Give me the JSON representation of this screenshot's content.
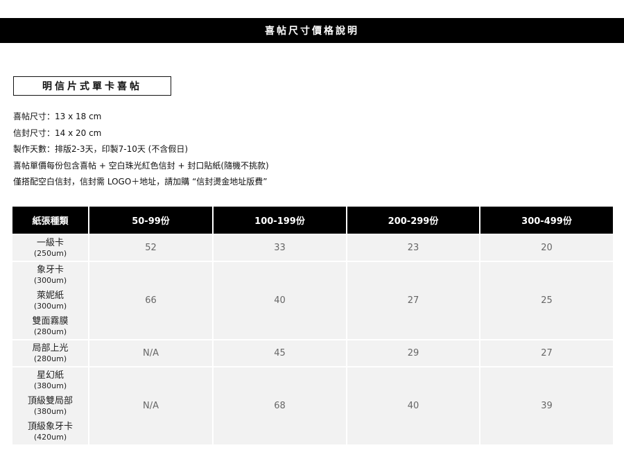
{
  "header": {
    "title": "喜帖尺寸價格說明"
  },
  "section": {
    "label": "明信片式單卡喜帖"
  },
  "info": [
    "喜帖尺寸：13 x 18 cm",
    "信封尺寸：14 x 20 cm",
    "製作天數：排版2-3天，印製7-10天 (不含假日)",
    "喜帖單價每份包含喜帖 + 空白珠光紅色信封 + 封口貼紙(隨機不挑款)",
    "僅搭配空白信封，信封需 LOGO＋地址，請加購 “信封燙金地址版費”"
  ],
  "table": {
    "headers": [
      "紙張種類",
      "50-99份",
      "100-199份",
      "200-299份",
      "300-499份"
    ],
    "rows": [
      {
        "papers": [
          {
            "name": "一級卡",
            "spec": "(250um)"
          }
        ],
        "prices": [
          "52",
          "33",
          "23",
          "20"
        ]
      },
      {
        "papers": [
          {
            "name": "象牙卡",
            "spec": "(300um)"
          },
          {
            "name": "萊妮紙",
            "spec": "(300um)"
          },
          {
            "name": "雙面霧膜",
            "spec": "(280um)"
          }
        ],
        "prices": [
          "66",
          "40",
          "27",
          "25"
        ]
      },
      {
        "papers": [
          {
            "name": "局部上光",
            "spec": "(280um)"
          }
        ],
        "prices": [
          "N/A",
          "45",
          "29",
          "27"
        ]
      },
      {
        "papers": [
          {
            "name": "星幻紙",
            "spec": "(380um)"
          },
          {
            "name": "頂級雙局部",
            "spec": "(380um)"
          },
          {
            "name": "頂級象牙卡",
            "spec": "(420um)"
          }
        ],
        "prices": [
          "N/A",
          "68",
          "40",
          "39"
        ]
      }
    ]
  }
}
